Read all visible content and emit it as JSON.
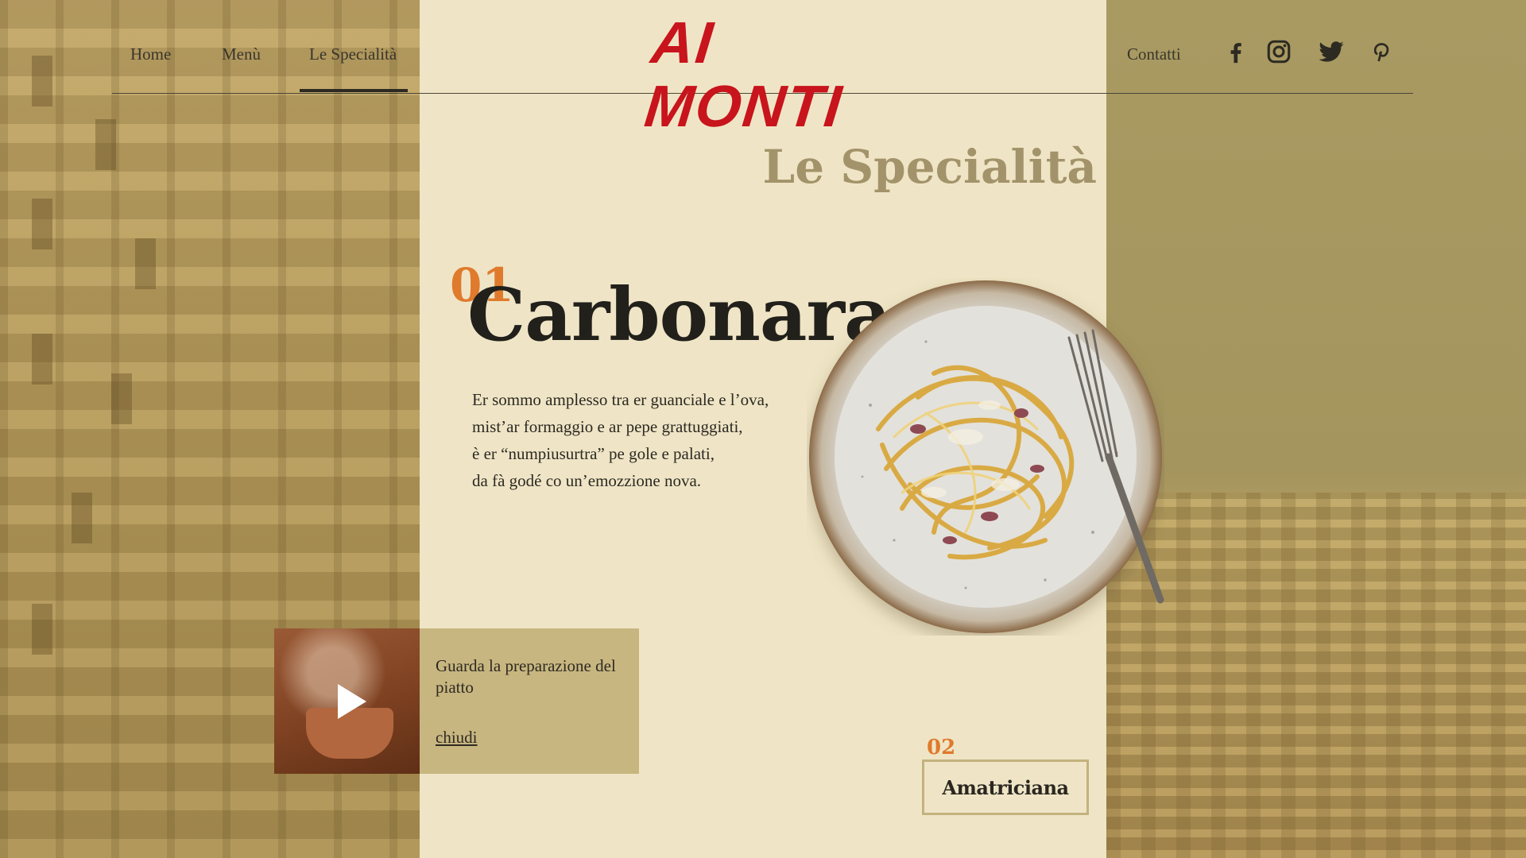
{
  "colors": {
    "panel": "#efe5c6",
    "accent_orange": "#e07a2c",
    "logo_red": "#c8141c",
    "muted_gold": "#a3936a",
    "card_gold": "#c8b680"
  },
  "header": {
    "logo": "AI MONTI",
    "nav": [
      {
        "label": "Home"
      },
      {
        "label": "Menù"
      },
      {
        "label": "Le Specialità",
        "active": true
      },
      {
        "label": "Contatti"
      }
    ],
    "social_icons": [
      "facebook-icon",
      "instagram-icon",
      "twitter-icon",
      "pinterest-icon"
    ]
  },
  "section": {
    "title": "Le Specialità"
  },
  "dish": {
    "number": "01",
    "name": "Carbonara",
    "description_lines": [
      "Er sommo amplesso tra er guanciale e l’ova,",
      "mist’ar formaggio e ar pepe grattuggiati,",
      "è er “numpiusurtra” pe gole e palati,",
      "da fà godé co un’emozzione nova."
    ]
  },
  "video": {
    "text": "Guarda la preparazione del piatto",
    "close_label": "chiudi"
  },
  "next": {
    "number": "02",
    "label": "Amatriciana"
  }
}
